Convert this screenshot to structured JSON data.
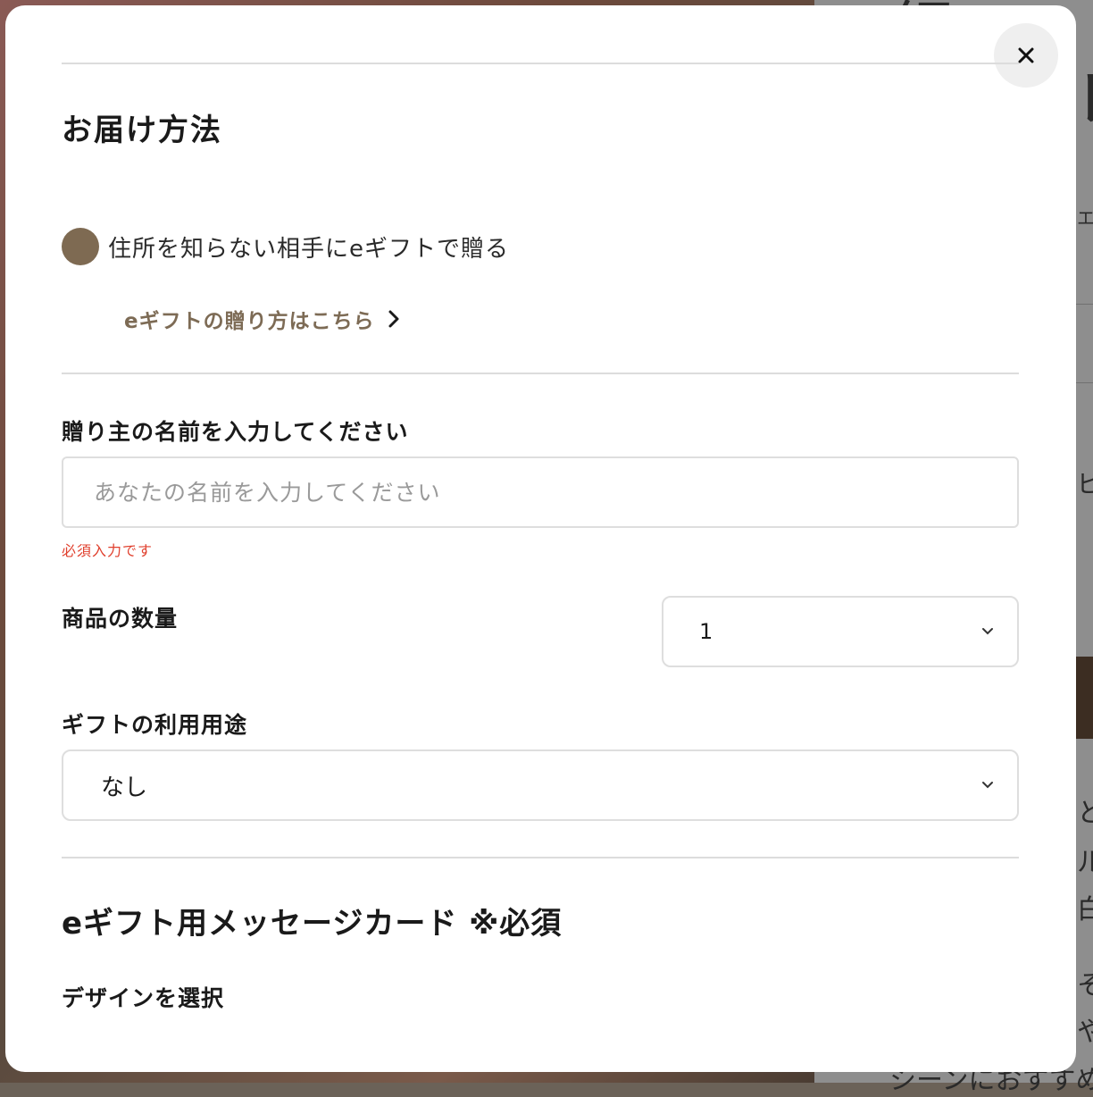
{
  "background": {
    "peek_top": "紹",
    "peek_top2": "レ",
    "peek_small1": "エ",
    "peek_small2": "ビ",
    "peek_side1": "と",
    "peek_side2": "ル",
    "peek_side3": "白",
    "peek_side4": "そ",
    "peek_side5": "や",
    "peek_bottom": "シーンにおすすめ"
  },
  "modal": {
    "close_icon": "close-icon",
    "delivery": {
      "heading": "お届け方法",
      "option_label": "住所を知らない相手にeギフトで贈る",
      "accent_color": "#7e6a52",
      "howto_link": "eギフトの贈り方はこちら"
    },
    "sender": {
      "label": "贈り主の名前を入力してください",
      "placeholder": "あなたの名前を入力してください",
      "error": "必須入力です",
      "error_color": "#e0402e"
    },
    "quantity": {
      "label": "商品の数量",
      "value": "1"
    },
    "usage": {
      "label": "ギフトの利用用途",
      "value": "なし"
    },
    "message_card": {
      "heading": "eギフト用メッセージカード ※必須",
      "design_label": "デザインを選択"
    }
  }
}
